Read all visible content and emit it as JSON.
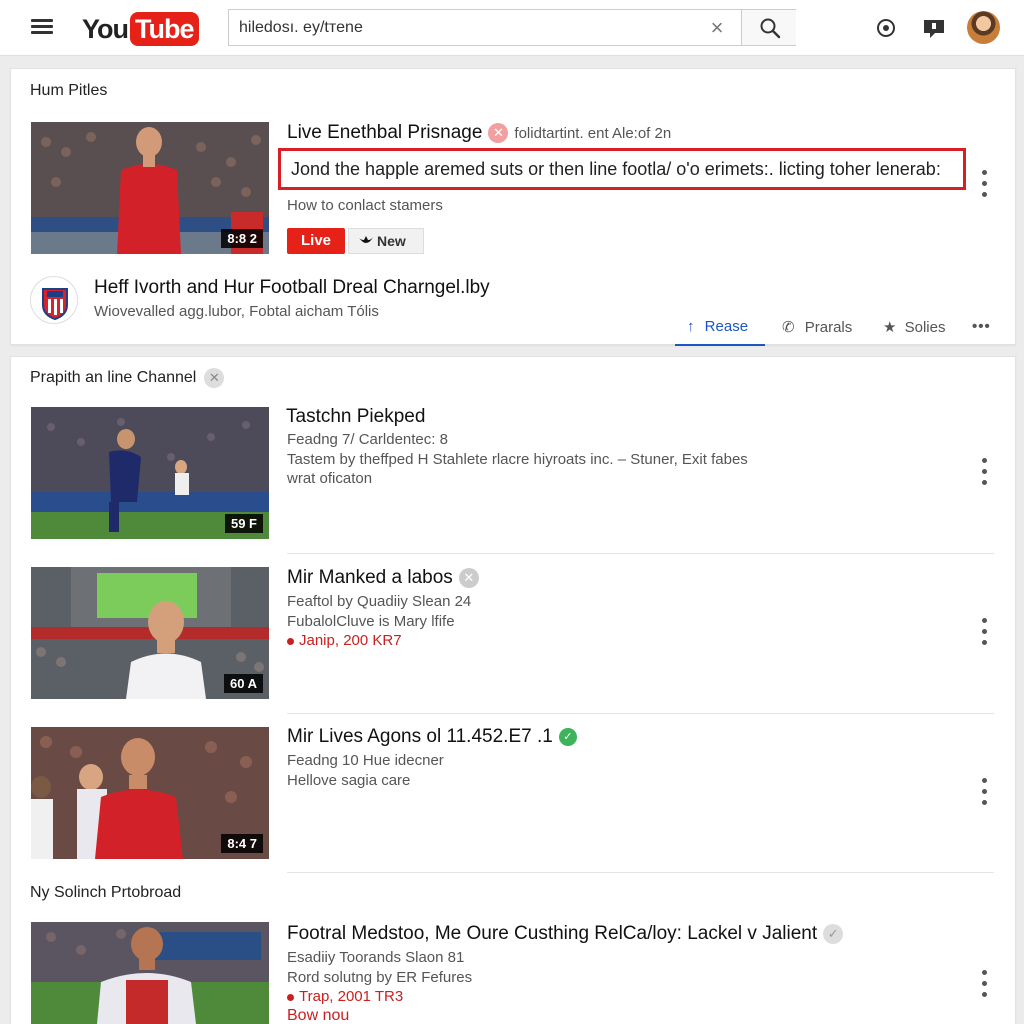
{
  "header": {
    "logo_you": "You",
    "logo_tube": "Tube",
    "search_value": "hiledosı. ey/tтene",
    "icons": [
      "menu-icon",
      "clear-icon",
      "search-icon",
      "upload-icon",
      "notifications-icon",
      "avatar"
    ]
  },
  "section1": {
    "title": "Hum Pitles",
    "video": {
      "title": "Live Enethbal Prisnage",
      "badge_text": "folidtartint. ent Ale:of 2n",
      "highlight_text": "Jond the happle aremed suts or then line footla/ o'o erimets:. licting toher lenerab:",
      "meta": "How to conlact stamers",
      "duration": "8:8 2",
      "live_label": "Live",
      "new_label": "New"
    },
    "channel": {
      "name": "Heff Ivorth and Hur Football Dreal Charngel.lby",
      "sub": "Wiovevalled agg.lubor, Fobtal aicham Tólis"
    },
    "tabs": [
      "Rease",
      "Prarals",
      "Solies"
    ]
  },
  "section2": {
    "title": "Prapith an line Channel",
    "videos": [
      {
        "title": "Tastchn Piekped",
        "meta1": "Feadng 7/ Carldentec: 8",
        "meta2": "Tastem by theffped H Stahlete rlacre hiyroats inc. – Stuner, Exit fabes",
        "meta3": "wrat oficaton",
        "duration": "59 F"
      },
      {
        "title": "Mir Manked a labos",
        "meta1": "Feaftol by Quadiiy Slean 24",
        "meta2": "FubalolCluve is Mary lfife",
        "meta3": "Janip, 200 KR7",
        "duration": "60 A"
      },
      {
        "title": "Mir Lives Agons ol 11.452.E7 .1",
        "meta1": "Feadng 10 Hue idecner",
        "meta2": "Hellove sagia care",
        "duration": "8:4 7"
      }
    ]
  },
  "section3": {
    "title": "Ny Solinch Prtobroad",
    "video": {
      "title": "Footral Medstoo, Me Oure Custhing RelCa/loy: Lackel v Jalient",
      "meta1": "Esadiiy Toorands Slaon 81",
      "meta2": "Rord solutng by ER Fefures",
      "meta3": "Trap, 2001 TR3",
      "meta4": "Bow nou"
    }
  },
  "colors": {
    "brand_red": "#e62117",
    "highlight_border": "#d81f26",
    "tab_active": "#1a57c4"
  }
}
